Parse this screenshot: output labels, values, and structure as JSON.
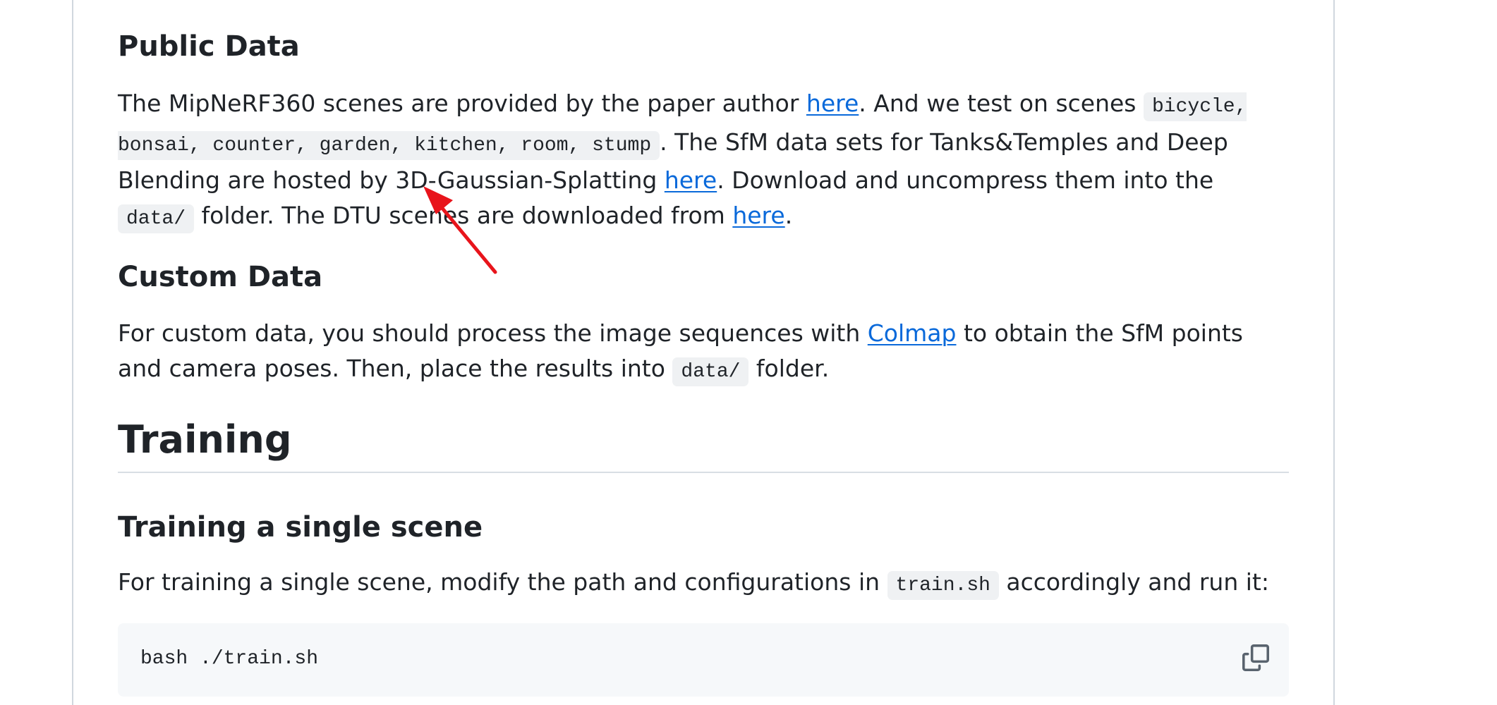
{
  "public_data": {
    "heading": "Public Data",
    "text_1": "The MipNeRF360 scenes are provided by the paper author ",
    "link_1": "here",
    "text_2": ". And we test on scenes ",
    "code_scenes": "bicycle, bonsai, counter, garden, kitchen, room, stump",
    "text_3": ". The SfM data sets for Tanks&Temples and Deep Blending are hosted by 3D-Gaussian-Splatting ",
    "link_2": "here",
    "text_4": ". Download and uncompress them into the ",
    "code_data": "data/",
    "text_5": " folder. The DTU scenes are downloaded from ",
    "link_3": "here",
    "text_6": "."
  },
  "custom_data": {
    "heading": "Custom Data",
    "text_1": "For custom data, you should process the image sequences with ",
    "link_colmap": "Colmap",
    "text_2": " to obtain the SfM points and camera poses. Then, place the results into ",
    "code_data": "data/",
    "text_3": " folder."
  },
  "training": {
    "heading": "Training"
  },
  "training_single": {
    "heading": "Training a single scene",
    "text_1": "For training a single scene, modify the path and configurations in ",
    "code_train": "train.sh",
    "text_2": " accordingly and run it:",
    "code_block": "bash ./train.sh"
  },
  "icons": {
    "copy": "copy-icon",
    "annotation": "red-arrow-annotation"
  },
  "colors": {
    "link": "#0969da",
    "code_bg": "#eff1f3",
    "codeblock_bg": "#f6f8fa",
    "annotation": "#e8141b"
  }
}
